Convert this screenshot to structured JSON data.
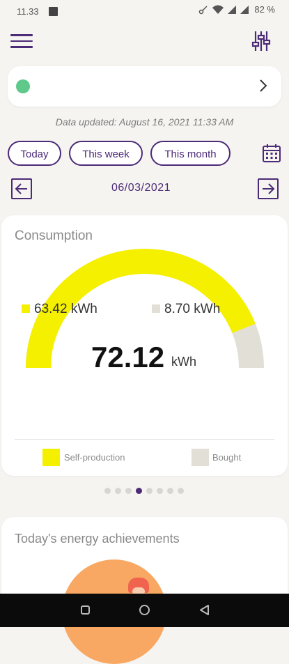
{
  "status_bar": {
    "time": "11.33",
    "battery": "82 %"
  },
  "header": {
    "menu_icon": "hamburger-menu-icon",
    "filter_icon": "sliders-icon"
  },
  "device": {
    "status_color": "#5ec98a",
    "chevron_icon": "chevron-right-icon"
  },
  "updated": "Data updated: August 16, 2021 11:33 AM",
  "tabs": [
    {
      "label": "Today"
    },
    {
      "label": "This week"
    },
    {
      "label": "This month"
    }
  ],
  "date_nav": {
    "date": "06/03/2021",
    "prev_icon": "arrow-left-icon",
    "next_icon": "arrow-right-icon"
  },
  "consumption": {
    "title": "Consumption",
    "self_value": "63.42 kWh",
    "bought_value": "8.70 kWh",
    "total": "72.12",
    "total_unit": "kWh",
    "legend_self": "Self-production",
    "legend_bought": "Bought",
    "colors": {
      "self": "#f5ef00",
      "bought": "#e2dfd6"
    }
  },
  "pager": {
    "count": 8,
    "active": 3
  },
  "achievements": {
    "title": "Today's energy achievements"
  },
  "theme": {
    "accent": "#4b2a77"
  }
}
